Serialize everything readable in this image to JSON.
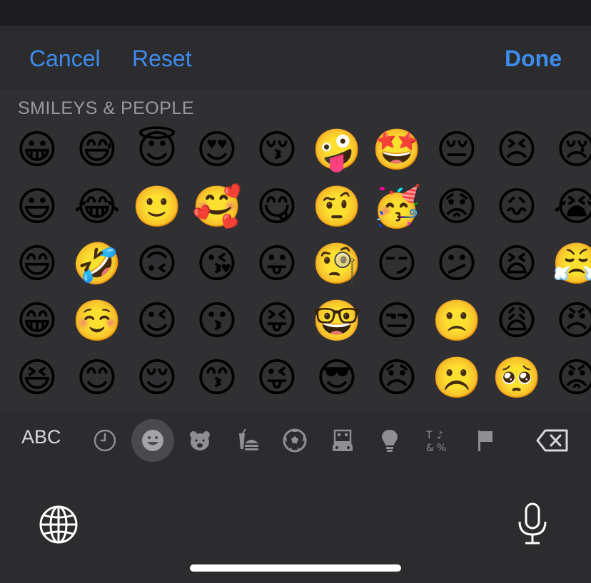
{
  "toolbar": {
    "cancel_label": "Cancel",
    "reset_label": "Reset",
    "done_label": "Done"
  },
  "emoji_section": {
    "title": "SMILEYS & PEOPLE",
    "rows": [
      [
        "😀",
        "😅",
        "😇",
        "😍",
        "😚",
        "🤪",
        "🤩",
        "😔",
        "😣",
        "😢"
      ],
      [
        "😃",
        "😂",
        "🙂",
        "🥰",
        "😋",
        "🤨",
        "🥳",
        "😟",
        "😖",
        "😭"
      ],
      [
        "😄",
        "🤣",
        "🙃",
        "😘",
        "😛",
        "🧐",
        "😏",
        "😕",
        "😫",
        "😤"
      ],
      [
        "😁",
        "☺️",
        "😉",
        "😗",
        "😝",
        "🤓",
        "😒",
        "🙁",
        "😩",
        "😠"
      ],
      [
        "😆",
        "😊",
        "😌",
        "😙",
        "😜",
        "😎",
        "😞",
        "☹️",
        "🥺",
        "😡"
      ]
    ]
  },
  "category_bar": {
    "abc_label": "ABC",
    "categories": [
      {
        "icon": "clock-icon",
        "selected": false
      },
      {
        "icon": "smiley-icon",
        "selected": true
      },
      {
        "icon": "bear-icon",
        "selected": false
      },
      {
        "icon": "food-icon",
        "selected": false
      },
      {
        "icon": "soccer-ball-icon",
        "selected": false
      },
      {
        "icon": "buildings-car-icon",
        "selected": false
      },
      {
        "icon": "lightbulb-icon",
        "selected": false
      },
      {
        "icon": "symbols-icon",
        "selected": false
      },
      {
        "icon": "flag-icon",
        "selected": false
      }
    ],
    "delete_icon": "delete-backspace-icon"
  },
  "bottom": {
    "globe_icon": "globe-icon",
    "mic_icon": "microphone-icon"
  },
  "colors": {
    "accent": "#3d8cf0",
    "keyboard_bg": "#2c2c2e",
    "panel_bg": "#303032",
    "icon_gray": "#8e8e93",
    "selected_bg": "#4a4a4d"
  }
}
